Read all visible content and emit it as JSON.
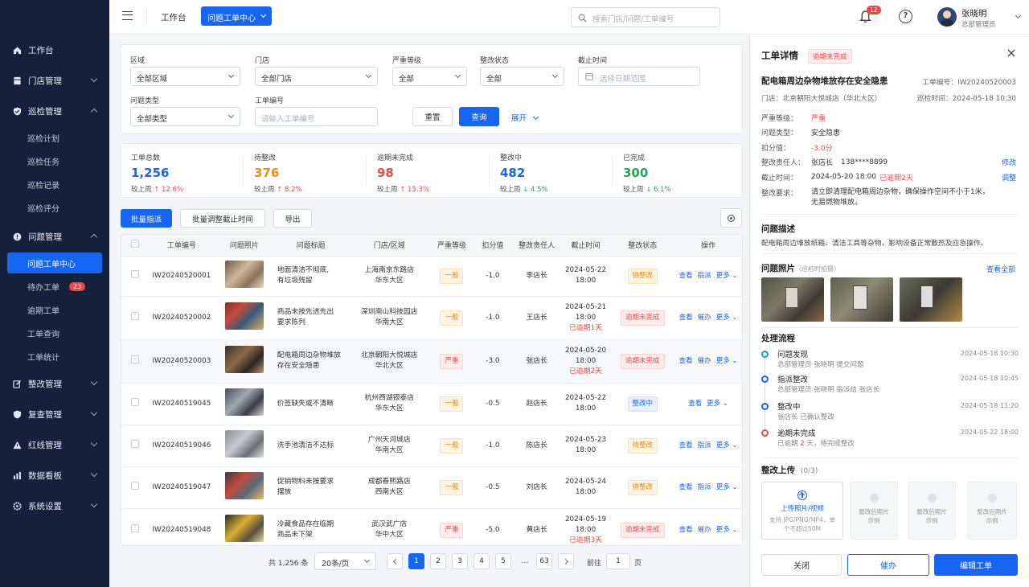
{
  "sidebar": {
    "items": [
      {
        "label": "工作台",
        "icon": "home-icon"
      },
      {
        "label": "门店管理",
        "icon": "store-icon"
      },
      {
        "label": "巡检管理",
        "icon": "shield-icon"
      },
      {
        "label": "问题管理",
        "icon": "alert-icon"
      },
      {
        "label": "整改管理",
        "icon": "edit-icon"
      },
      {
        "label": "复查管理",
        "icon": "check-shield-icon"
      },
      {
        "label": "红线管理",
        "icon": "warning-icon"
      },
      {
        "label": "数据看板",
        "icon": "chart-icon"
      },
      {
        "label": "系统设置",
        "icon": "gear-icon"
      }
    ],
    "inspection_sub": [
      "巡检计划",
      "巡检任务",
      "巡检记录",
      "巡检评分"
    ],
    "problem_sub": [
      "问题工单中心",
      "待办工单",
      "逾期工单",
      "工单查询",
      "工单统计"
    ],
    "todo_badge": "23"
  },
  "topbar": {
    "tab_workbench": "工作台",
    "tab_active": "问题工单中心",
    "search_placeholder": "搜索门店/问题/工单编号",
    "notif_count": "12",
    "user_name": "张晓明",
    "user_role": "总部管理员"
  },
  "filters": {
    "region_label": "区域",
    "region_value": "全部区域",
    "store_label": "门店",
    "store_value": "全部门店",
    "severity_label": "严重等级",
    "severity_value": "全部",
    "status_label": "整改状态",
    "status_value": "全部",
    "deadline_label": "截止时间",
    "deadline_placeholder": "选择日期范围",
    "type_label": "问题类型",
    "type_value": "全部类型",
    "no_label": "工单编号",
    "no_placeholder": "请输入工单编号",
    "reset": "重置",
    "query": "查询",
    "expand": "展开"
  },
  "stats": [
    {
      "label": "工单总数",
      "value": "1,256",
      "cmp": "较上周",
      "delta": "↑ 12.6%",
      "dir": "up",
      "color": "#1765f3"
    },
    {
      "label": "待整改",
      "value": "376",
      "cmp": "较上周",
      "delta": "↑ 8.2%",
      "dir": "up",
      "color": "#e8901a"
    },
    {
      "label": "逾期未完成",
      "value": "98",
      "cmp": "较上周",
      "delta": "↑ 15.3%",
      "dir": "up",
      "color": "#e84a4a"
    },
    {
      "label": "整改中",
      "value": "482",
      "cmp": "较上周",
      "delta": "↓ 4.5%",
      "dir": "down",
      "color": "#1765f3"
    },
    {
      "label": "已完成",
      "value": "300",
      "cmp": "较上周",
      "delta": "↓ 6.1%",
      "dir": "down",
      "color": "#2aa35a"
    }
  ],
  "actions": {
    "batch_assign": "批量指派",
    "batch_deadline": "批量调整截止时间",
    "export": "导出"
  },
  "table": {
    "headers": [
      "工单编号",
      "问题照片",
      "问题标题",
      "门店/区域",
      "严重等级",
      "扣分值",
      "整改责任人",
      "截止时间",
      "整改状态",
      "操作"
    ],
    "rows": [
      {
        "no": "IW20240520001",
        "title1": "地面清洁不彻底,",
        "title2": "有垃圾残留",
        "store": "上海南京东路店",
        "region": "华东大区",
        "sev": "一般",
        "score": "-1.0",
        "owner": "李店长",
        "date": "2024-05-22",
        "time": "18:00",
        "overdue": "",
        "status": "待整改",
        "actions": [
          "查看",
          "指派",
          "更多"
        ]
      },
      {
        "no": "IW20240520002",
        "title1": "商品未按先进先出",
        "title2": "要求陈列",
        "store": "深圳南山科技园店",
        "region": "华南大区",
        "sev": "一般",
        "score": "-1.0",
        "owner": "王店长",
        "date": "2024-05-21",
        "time": "18:00",
        "overdue": "已逾期1天",
        "status": "逾期未完成",
        "actions": [
          "查看",
          "催办",
          "更多"
        ]
      },
      {
        "no": "IW20240520003",
        "title1": "配电箱周边杂物堆放",
        "title2": "存在安全隐患",
        "store": "北京朝阳大悦城店",
        "region": "华北大区",
        "sev": "严重",
        "score": "-3.0",
        "owner": "张店长",
        "date": "2024-05-20",
        "time": "18:00",
        "overdue": "已逾期2天",
        "status": "逾期未完成",
        "actions": [
          "查看",
          "催办",
          "更多"
        ]
      },
      {
        "no": "IW20240519045",
        "title1": "价签缺失或不清晰",
        "title2": "",
        "store": "杭州西湖银泰店",
        "region": "华东大区",
        "sev": "一般",
        "score": "-0.5",
        "owner": "赵店长",
        "date": "2024-05-22",
        "time": "18:00",
        "overdue": "",
        "status": "整改中",
        "actions": [
          "查看",
          "更多"
        ]
      },
      {
        "no": "IW20240519046",
        "title1": "洗手池清洁不达标",
        "title2": "",
        "store": "广州天河城店",
        "region": "华南大区",
        "sev": "一般",
        "score": "-1.0",
        "owner": "陈店长",
        "date": "2024-05-23",
        "time": "18:00",
        "overdue": "",
        "status": "待整改",
        "actions": [
          "查看",
          "指派",
          "更多"
        ]
      },
      {
        "no": "IW20240519047",
        "title1": "促销物料未按要求",
        "title2": "摆放",
        "store": "成都春熙路店",
        "region": "西南大区",
        "sev": "一般",
        "score": "-0.5",
        "owner": "刘店长",
        "date": "2024-05-24",
        "time": "18:00",
        "overdue": "",
        "status": "待整改",
        "actions": [
          "查看",
          "指派",
          "更多"
        ]
      },
      {
        "no": "IW20240519048",
        "title1": "冷藏食品存在临期",
        "title2": "商品未下架",
        "store": "武汉武广店",
        "region": "华中大区",
        "sev": "严重",
        "score": "-5.0",
        "owner": "黄店长",
        "date": "2024-05-19",
        "time": "18:00",
        "overdue": "已逾期3天",
        "status": "逾期未完成",
        "actions": [
          "查看",
          "催办",
          "更多"
        ]
      }
    ]
  },
  "pagination": {
    "total": "共 1,256 条",
    "page_size": "20条/页",
    "pages": [
      "1",
      "2",
      "3",
      "4",
      "5",
      "…",
      "63"
    ],
    "goto_label": "前往",
    "goto_value": "1",
    "page_unit": "页"
  },
  "detail": {
    "title": "工单详情",
    "status_badge": "逾期未完成",
    "problem_title": "配电箱周边杂物堆放存在安全隐患",
    "order_no": "工单编号：IW20240520003",
    "store": "门店：北京朝阳大悦城店（华北大区）",
    "inspect_time": "巡检时间：2024-05-18 10:30",
    "props": [
      {
        "k": "严重等级：",
        "v": "严重",
        "cls": "redtxt"
      },
      {
        "k": "问题类型：",
        "v": "安全隐患",
        "cls": ""
      },
      {
        "k": "扣分值：",
        "v": "-3.0分",
        "cls": "redtxt"
      }
    ],
    "owner_k": "整改责任人：",
    "owner_v": "张店长",
    "owner_phone": "138****8899",
    "modify": "修改",
    "deadline_k": "截止时间：",
    "deadline_v": "2024-05-20 18:00",
    "deadline_overdue": "已逾期2天",
    "adjust": "调整",
    "require_k": "整改要求：",
    "require_v1": "请立即清理配电箱周边杂物，确保操作空间不小于1米，",
    "require_v2": "无易燃物堆放。",
    "desc_title": "问题描述",
    "desc": "配电箱周边堆放纸箱、清洁工具等杂物，影响设备正常散热及应急操作。",
    "photos_title": "问题照片",
    "photos_note": "（巡检时拍摄）",
    "view_all": "查看全部",
    "flow_title": "处理流程",
    "flow": [
      {
        "t": "问题发现",
        "d": "总部管理员 张晓明 提交问题",
        "time": "2024-05-18 10:30",
        "color": "#19a0a0"
      },
      {
        "t": "指派整改",
        "d": "总部管理员 张晓明 指派给 张店长",
        "time": "2024-05-18 10:45",
        "color": "#1765f3"
      },
      {
        "t": "整改中",
        "d": "张店长 已确认整改",
        "time": "2024-05-18 11:20",
        "color": "#1765f3"
      },
      {
        "t": "逾期未完成",
        "d1": "已逾期 ",
        "d2": "2",
        "d3": " 天，待完成整改",
        "time": "2024-05-22 18:00",
        "color": "#e84a4a"
      }
    ],
    "upload_title": "整改上传",
    "upload_count": "(0/3)",
    "upload_main": "上传照片/视频",
    "upload_hint1": "支持 JPG/PNG/MP4，单",
    "upload_hint2": "个不超过50M",
    "samples": [
      {
        "a": "整改后照片",
        "b": "示例"
      },
      {
        "a": "整改后照片",
        "b": "示例"
      },
      {
        "a": "整改后照片",
        "b": "示例"
      }
    ],
    "close": "关闭",
    "urge": "催办",
    "edit": "编辑工单"
  }
}
